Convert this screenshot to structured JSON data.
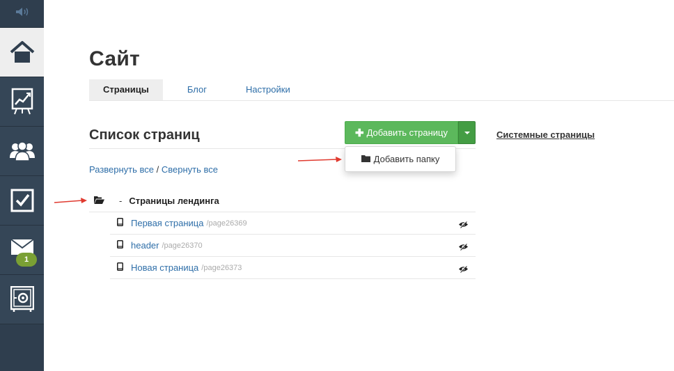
{
  "sidebar": {
    "items": [
      {
        "icon": "volume-icon"
      },
      {
        "icon": "home-icon",
        "active": true
      },
      {
        "icon": "chart-board-icon"
      },
      {
        "icon": "users-icon"
      },
      {
        "icon": "checkbox-icon"
      },
      {
        "icon": "mail-icon",
        "badge": "1"
      },
      {
        "icon": "safe-icon"
      }
    ]
  },
  "page": {
    "title": "Сайт",
    "tabs": [
      {
        "label": "Страницы",
        "active": true
      },
      {
        "label": "Блог",
        "active": false
      },
      {
        "label": "Настройки",
        "active": false
      }
    ]
  },
  "list": {
    "title": "Список страниц",
    "add_button": "Добавить страницу",
    "add_folder": "Добавить папку",
    "system_pages": "Системные страницы",
    "expand_all": "Развернуть все",
    "separator": " / ",
    "collapse_all": "Свернуть все",
    "folder": {
      "dash": "-",
      "name": "Страницы лендинга"
    },
    "pages": [
      {
        "name": "Первая страница",
        "slug": "/page26369"
      },
      {
        "name": "header",
        "slug": "/page26370"
      },
      {
        "name": "Новая страница",
        "slug": "/page26373"
      }
    ]
  },
  "colors": {
    "sidebar_bg": "#2f3e4e",
    "accent_green": "#5cb85c",
    "link_blue": "#2e6ea8",
    "badge_green": "#7aa034",
    "annotation_red": "#e03a2f"
  }
}
